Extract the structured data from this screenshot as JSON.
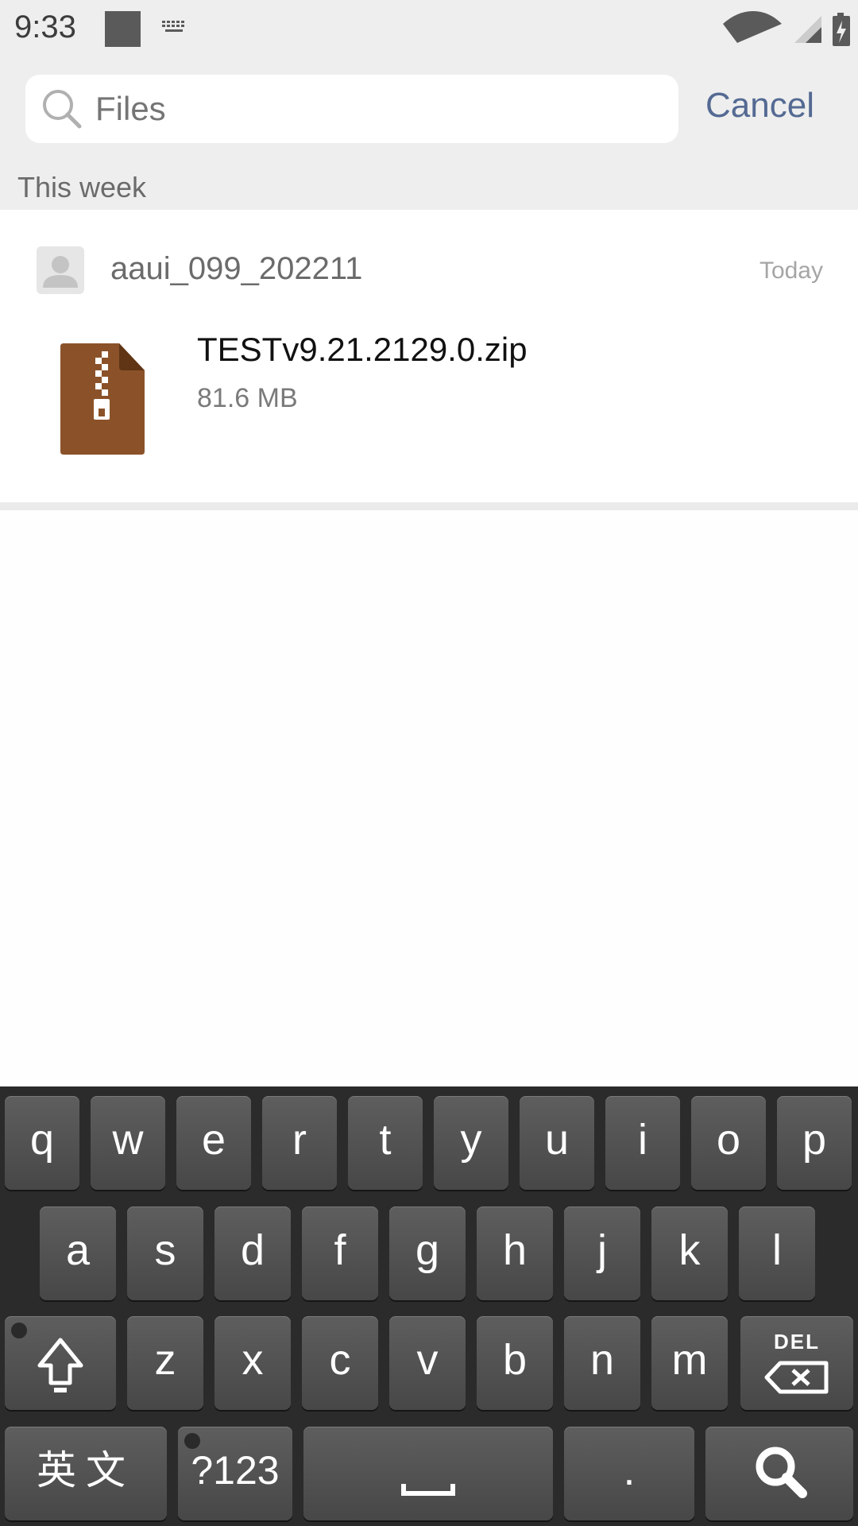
{
  "status_bar": {
    "time": "9:33",
    "icons": [
      "notification-square-icon",
      "keyboard-icon",
      "wifi-icon",
      "cellular-signal-icon",
      "battery-charging-icon"
    ]
  },
  "search": {
    "placeholder": "Files",
    "cancel_label": "Cancel",
    "section_label": "This week"
  },
  "results": [
    {
      "sender": "aaui_099_202211",
      "time": "Today",
      "file_name": "TESTv9.21.2129.0.zip",
      "file_size": "81.6 MB",
      "file_icon": "zip-archive-icon",
      "file_icon_color": "#8b5229"
    }
  ],
  "keyboard": {
    "row1": [
      "q",
      "w",
      "e",
      "r",
      "t",
      "y",
      "u",
      "i",
      "o",
      "p"
    ],
    "row2": [
      "a",
      "s",
      "d",
      "f",
      "g",
      "h",
      "j",
      "k",
      "l"
    ],
    "row3": [
      "z",
      "x",
      "c",
      "v",
      "b",
      "n",
      "m"
    ],
    "shift_icon": "shift-arrow-icon",
    "delete_label": "DEL",
    "lang_label": "英文",
    "symbols_label": "?123",
    "space_icon": "space-bar-icon",
    "period_label": ".",
    "search_icon": "search-icon"
  },
  "colors": {
    "accent": "#546a93",
    "header_bg": "#eeeeee",
    "keyboard_bg": "#2b2b2b"
  }
}
